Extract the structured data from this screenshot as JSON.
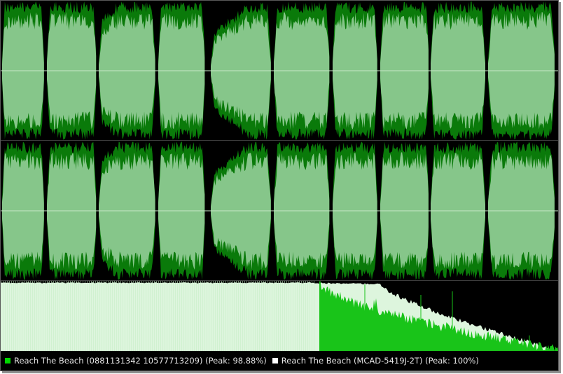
{
  "legend": [
    {
      "label": "Reach The Beach (0881131342 10577713209) (Peak: 98.88%)",
      "color": "#00d800"
    },
    {
      "label": "Reach The Beach (MCAD-5419J-2T) (Peak: 100%)",
      "color": "#ffffff"
    }
  ],
  "colors": {
    "background": "#000000",
    "track_a_waveform": "#0a7a0a",
    "track_b_waveform": "#86c68a",
    "centerline": "#c8e8c8",
    "track_b_spectrum": "#ddf5dd",
    "track_a_spectrum": "#19c419"
  }
}
